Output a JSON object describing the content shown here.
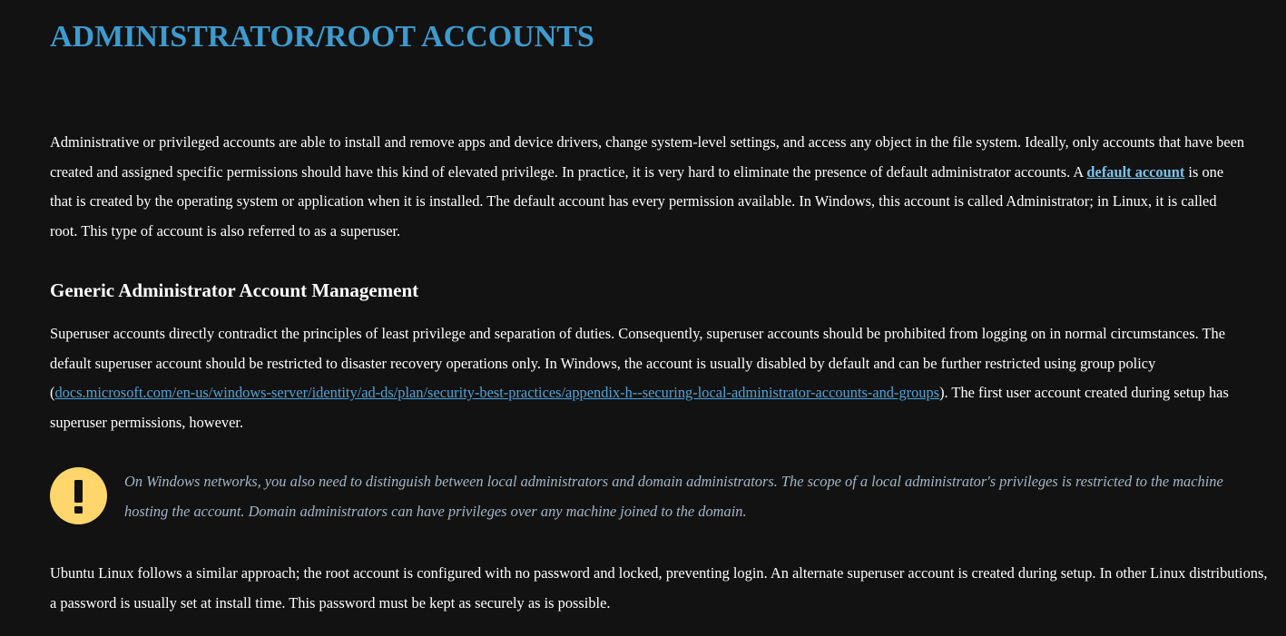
{
  "title": "ADMINISTRATOR/ROOT ACCOUNTS",
  "intro": {
    "before_link": "Administrative or privileged accounts are able to install and remove apps and device drivers, change system-level settings, and access any object in the file system. Ideally, only accounts that have been created and assigned specific permissions should have this kind of elevated privilege. In practice, it is very hard to eliminate the presence of default administrator accounts. A ",
    "link_text": "default account",
    "after_link": " is one that is created by the operating system or application when it is installed. The default account has every permission available. In Windows, this account is called Administrator; in Linux, it is called root. This type of account is also referred to as a superuser."
  },
  "section": {
    "heading": "Generic Administrator Account Management",
    "para1": {
      "before_link": "Superuser accounts directly contradict the principles of least privilege and separation of duties. Consequently, superuser accounts should be prohibited from logging on in normal circumstances. The default superuser account should be restricted to disaster recovery operations only. In Windows, the account is usually disabled by default and can be further restricted using group policy (",
      "link_text": "docs.microsoft.com/en-us/windows-server/identity/ad-ds/plan/security-best-practices/appendix-h--securing-local-administrator-accounts-and-groups",
      "after_link": "). The first user account created during setup has superuser permissions, however."
    },
    "note": {
      "icon": "exclamation-icon",
      "icon_color": "#fed66c",
      "text": "On Windows networks, you also need to distinguish between local administrators and domain administrators. The scope of a local administrator's privileges is restricted to the machine hosting the account. Domain administrators can have privileges over any machine joined to the domain."
    },
    "para2": "Ubuntu Linux follows a similar approach; the root account is configured with no password and locked, preventing login. An alternate superuser account is created during setup. In other Linux distributions, a password is usually set at install time. This password must be kept as securely as is possible."
  },
  "colors": {
    "background": "#121212",
    "title": "#3d9bcf",
    "link": "#4fa3d9",
    "note_text": "#a5b6c6"
  }
}
